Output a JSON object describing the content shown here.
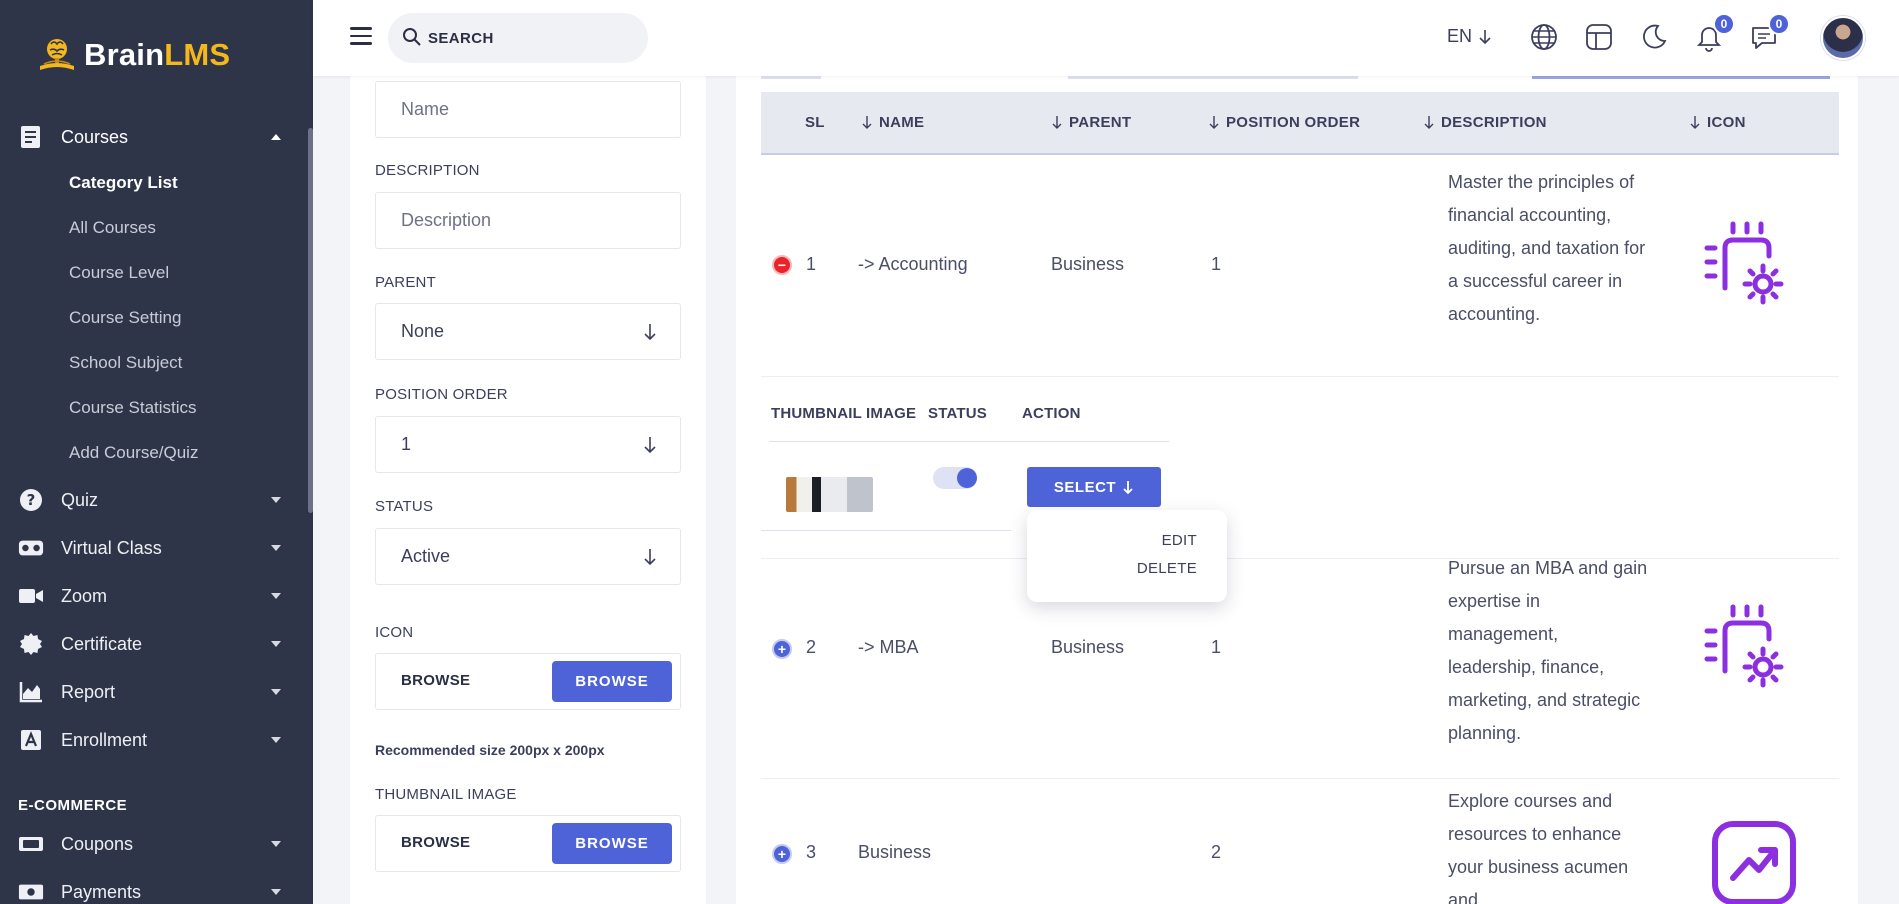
{
  "brand": {
    "name_part1": "Brain",
    "name_part2": "LMS"
  },
  "sidebar": {
    "courses": {
      "label": "Courses"
    },
    "course_subitems": [
      "Category List",
      "All Courses",
      "Course Level",
      "Course Setting",
      "School Subject",
      "Course Statistics",
      "Add Course/Quiz"
    ],
    "items": [
      {
        "label": "Quiz",
        "icon": "question-icon"
      },
      {
        "label": "Virtual Class",
        "icon": "vr-headset-icon"
      },
      {
        "label": "Zoom",
        "icon": "video-camera-icon"
      },
      {
        "label": "Certificate",
        "icon": "certificate-seal-icon"
      },
      {
        "label": "Report",
        "icon": "area-chart-icon"
      },
      {
        "label": "Enrollment",
        "icon": "enrollment-icon"
      }
    ],
    "ecommerce_section": "E-COMMERCE",
    "ecommerce_items": [
      {
        "label": "Coupons",
        "icon": "ticket-icon"
      },
      {
        "label": "Payments",
        "icon": "money-icon"
      }
    ]
  },
  "header": {
    "search_placeholder": "SEARCH",
    "language": "EN",
    "notifications_count": "0",
    "messages_count": "0"
  },
  "form": {
    "name_placeholder": "Name",
    "description_label": "DESCRIPTION",
    "description_placeholder": "Description",
    "parent_label": "PARENT",
    "parent_value": "None",
    "position_label": "POSITION ORDER",
    "position_value": "1",
    "status_label": "STATUS",
    "status_value": "Active",
    "icon_label": "ICON",
    "browse_text": "BROWSE",
    "browse_button": "BROWSE",
    "recommended_note": "Recommended size 200px x 200px",
    "thumbnail_label": "THUMBNAIL IMAGE"
  },
  "table": {
    "columns": {
      "sl": "SL",
      "name": "NAME",
      "parent": "PARENT",
      "position": "POSITION ORDER",
      "description": "DESCRIPTION",
      "icon": "ICON"
    },
    "rows": [
      {
        "sl": "1",
        "name": "-> Accounting",
        "parent": "Business",
        "position": "1",
        "description": "Master the principles of financial accounting, auditing, and taxation for a successful career in accounting.",
        "expanded": true
      },
      {
        "sl": "2",
        "name": "-> MBA",
        "parent": "Business",
        "position": "1",
        "description": "Pursue an MBA and gain expertise in management, leadership, finance, marketing, and strategic planning.",
        "expanded": false
      },
      {
        "sl": "3",
        "name": "Business",
        "parent": "",
        "position": "2",
        "description": "Explore courses and resources to enhance your business acumen and",
        "expanded": false
      }
    ],
    "child": {
      "thumbnail_header": "THUMBNAIL IMAGE",
      "status_header": "STATUS",
      "action_header": "ACTION",
      "status_on": true,
      "select_label": "SELECT",
      "menu": [
        "EDIT",
        "DELETE"
      ]
    }
  },
  "colors": {
    "sidebar_bg": "#2f3548",
    "accent": "#4f63d8",
    "brand_gold": "#f4b81c",
    "icon_purple": "#8b2fe0",
    "danger": "#e8232a"
  }
}
